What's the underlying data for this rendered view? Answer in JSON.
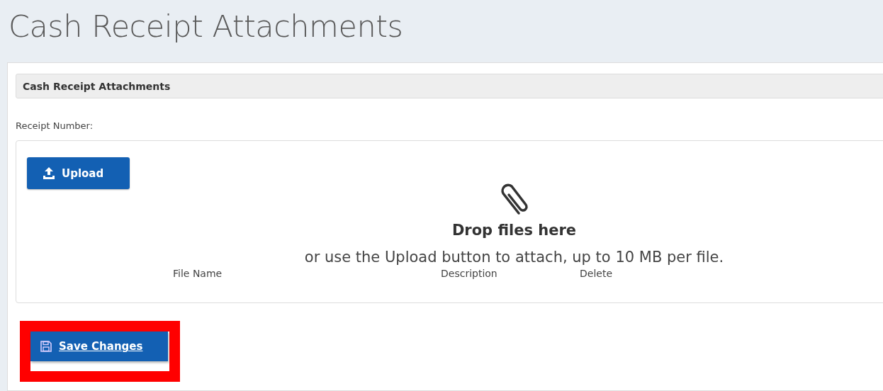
{
  "page": {
    "title": "Cash Receipt Attachments"
  },
  "section": {
    "title": "Cash Receipt Attachments"
  },
  "field": {
    "label": "Receipt Number:"
  },
  "upload": {
    "button": "Upload",
    "heading": "Drop files here",
    "hint": "or use the Upload button to attach, up to 10 MB per file."
  },
  "columns": [
    "File Name",
    "Description",
    "Delete"
  ],
  "save_button": {
    "label": "Save Changes",
    "highlighted": true
  }
}
